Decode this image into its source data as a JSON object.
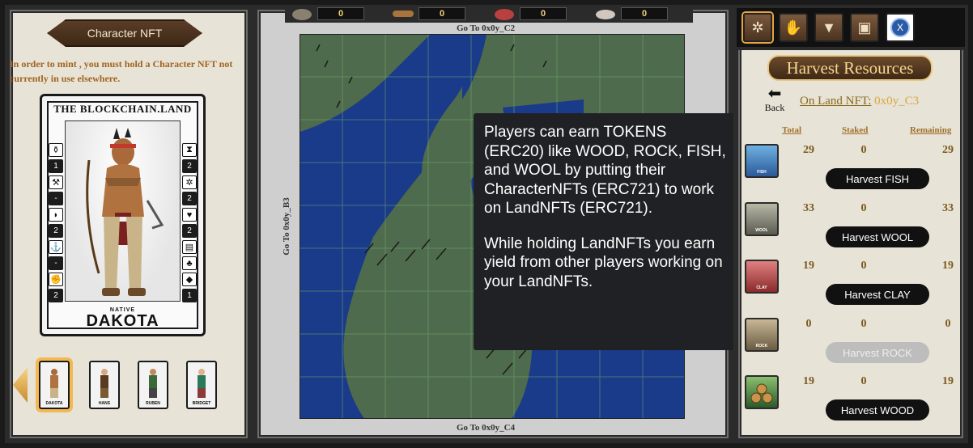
{
  "left_panel": {
    "title": "Character NFT",
    "mint_note": "In order to mint , you must hold a Character NFT not currently in use elsewhere.",
    "card": {
      "brand": "THE BLOCKCHAIN.LAND",
      "subtitle": "NATIVE",
      "name": "DAKOTA",
      "left_stats": [
        "1",
        "-",
        "2",
        "-",
        "2"
      ],
      "right_stats": [
        "2",
        "2",
        "2",
        "1"
      ],
      "icons": [
        "bottle-icon",
        "hammer-icon",
        "fist-icon",
        "horn-icon",
        "anchor-icon",
        "arm-icon",
        "hourglass-icon",
        "compass-icon",
        "grinder-icon",
        "heart-icon",
        "book-icon",
        "clover-icon",
        "cube-icon"
      ]
    },
    "thumbnails": [
      {
        "name": "DAKOTA",
        "selected": true
      },
      {
        "name": "HANS",
        "selected": false
      },
      {
        "name": "RUBEN",
        "selected": false
      },
      {
        "name": "BRIDGET",
        "selected": false
      }
    ]
  },
  "resource_bar": [
    {
      "icon": "rock-icon",
      "count": "0"
    },
    {
      "icon": "wood-icon",
      "count": "0"
    },
    {
      "icon": "clay-icon",
      "count": "0"
    },
    {
      "icon": "wool-icon",
      "count": "0"
    }
  ],
  "map": {
    "top_label": "Go To 0x0y_C2",
    "bottom_label": "Go To 0x0y_C4",
    "left_label": "Go To 0x0y_B3"
  },
  "tooltip": {
    "p1": "Players can earn TOKENS (ERC20) like WOOD, ROCK, FISH, and WOOL by putting their CharacterNFTs (ERC721) to work on LandNFTs (ERC721).",
    "p2": "While holding LandNFTs you earn yield from other players working on your LandNFTs."
  },
  "right_panel": {
    "nav_icons": [
      "compass-icon",
      "handshake-icon",
      "anvil-icon",
      "chest-icon",
      "close-icon"
    ],
    "close_label": "X",
    "title": "Harvest Resources",
    "back_label": "Back",
    "on_land_label": "On Land NFT:",
    "on_land_value": "0x0y_C3",
    "columns": {
      "total": "Total",
      "staked": "Staked",
      "remaining": "Remaining"
    },
    "resources": [
      {
        "label": "FISH",
        "total": "29",
        "staked": "0",
        "remaining": "29",
        "button": "Harvest FISH",
        "enabled": true,
        "color": "#4a8fc8"
      },
      {
        "label": "WOOL",
        "total": "33",
        "staked": "0",
        "remaining": "33",
        "button": "Harvest WOOL",
        "enabled": true,
        "color": "#8a8a80"
      },
      {
        "label": "CLAY",
        "total": "19",
        "staked": "0",
        "remaining": "19",
        "button": "Harvest CLAY",
        "enabled": true,
        "color": "#c85050"
      },
      {
        "label": "ROCK",
        "total": "0",
        "staked": "0",
        "remaining": "0",
        "button": "Harvest ROCK",
        "enabled": false,
        "color": "#9a8a70"
      },
      {
        "label": "",
        "total": "19",
        "staked": "0",
        "remaining": "19",
        "button": "Harvest WOOD",
        "enabled": true,
        "color": "#4a7a3a"
      }
    ]
  }
}
